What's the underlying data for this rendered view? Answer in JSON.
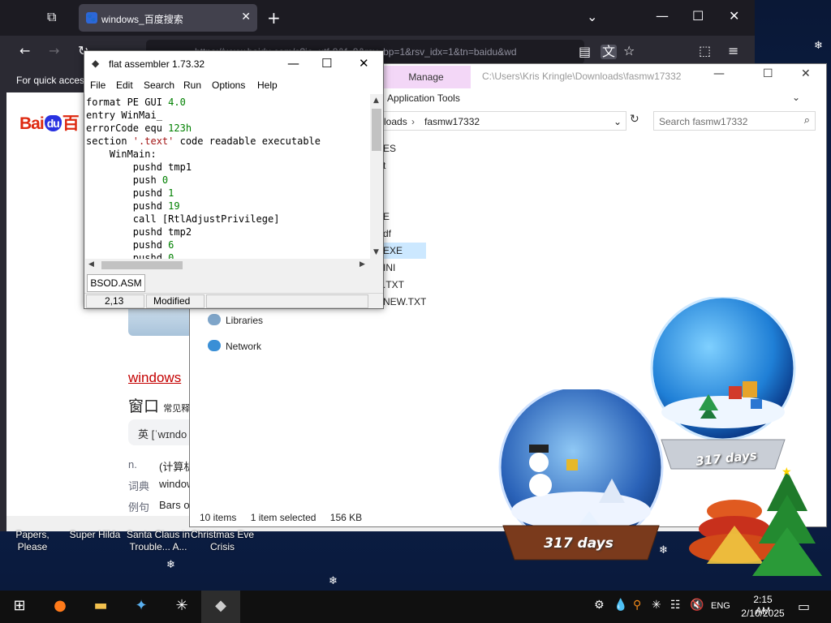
{
  "browser": {
    "tab_title": "windows_百度搜索",
    "url": "https://www.baidu.com/s?ie=utf-8&f=8&rsv_bp=1&rsv_idx=1&tn=baidu&wd",
    "bookmarks_text": "For quick access",
    "page": {
      "logo_text_left": "Bai",
      "logo_text_du": "du",
      "logo_text_right": "百",
      "result_title": "windows",
      "dict_word": "窗口",
      "dict_word_note": "常见释",
      "phonetic": "英 [ˈwɪndo",
      "rows": [
        {
          "label": "n.",
          "value": "(计算机"
        },
        {
          "label": "词典",
          "value": "window"
        },
        {
          "label": "例句",
          "value": "Bars o"
        }
      ]
    }
  },
  "explorer": {
    "manage_tab": "Manage",
    "title_path": "C:\\Users\\Kris Kringle\\Downloads\\fasmw17332",
    "app_tools": "Application Tools",
    "address_prefix": "loads",
    "address_folder": "fasmw17332",
    "search_placeholder": "Search fasmw17332",
    "files": [
      "ES",
      "t",
      "E",
      "df",
      "EXE",
      "INI",
      ".TXT",
      "NEW.TXT"
    ],
    "nav": {
      "libraries": "Libraries",
      "network": "Network"
    },
    "status": {
      "items": "10 items",
      "selected": "1 item selected",
      "size": "156 KB"
    }
  },
  "fasm": {
    "title": "flat assembler 1.73.32",
    "menu": [
      "File",
      "Edit",
      "Search",
      "Run",
      "Options",
      "Help"
    ],
    "code": [
      [
        {
          "t": "format PE GUI "
        },
        {
          "t": "4.0",
          "c": "num"
        }
      ],
      [
        {
          "t": "entry WinMai_"
        }
      ],
      [
        {
          "t": "errorCode equ "
        },
        {
          "t": "123h",
          "c": "num"
        }
      ],
      [
        {
          "t": "section "
        },
        {
          "t": "'.text'",
          "c": "str"
        },
        {
          "t": " code readable executable"
        }
      ],
      [
        {
          "t": "    WinMain:"
        }
      ],
      [
        {
          "t": "        pushd tmp1"
        }
      ],
      [
        {
          "t": "        push "
        },
        {
          "t": "0",
          "c": "num"
        }
      ],
      [
        {
          "t": "        pushd "
        },
        {
          "t": "1",
          "c": "num"
        }
      ],
      [
        {
          "t": "        pushd "
        },
        {
          "t": "19",
          "c": "num"
        }
      ],
      [
        {
          "t": "        call [RtlAdjustPrivilege]"
        }
      ],
      [
        {
          "t": "        pushd tmp2"
        }
      ],
      [
        {
          "t": "        pushd "
        },
        {
          "t": "6",
          "c": "num"
        }
      ],
      [
        {
          "t": "        pushd "
        },
        {
          "t": "0",
          "c": "num"
        }
      ]
    ],
    "file_tab": "BSOD.ASM",
    "status_position": "2,13",
    "status_modified": "Modified"
  },
  "desktop_icons": [
    {
      "label": "Papers, Please"
    },
    {
      "label": "Super Hilda"
    },
    {
      "label": "Santa Claus in Trouble... A..."
    },
    {
      "label": "Christmas Eve Crisis"
    }
  ],
  "gadgets": {
    "globe_small_days": "317 days",
    "globe_large_days": "317 days"
  },
  "taskbar": {
    "language": "ENG",
    "time": "2:15 AM",
    "date": "2/10/2025",
    "apps": [
      "start-icon",
      "firefox-icon",
      "file-explorer-icon",
      "app-icon",
      "snowflake-icon",
      "fasm-icon"
    ]
  },
  "colors": {
    "fasm_number": "#008000",
    "fasm_string": "#a31515",
    "manage_tab": "#f3d7f7",
    "baidu_red": "#de2910",
    "baidu_blue": "#2932e1",
    "result_title": "#c40000"
  }
}
